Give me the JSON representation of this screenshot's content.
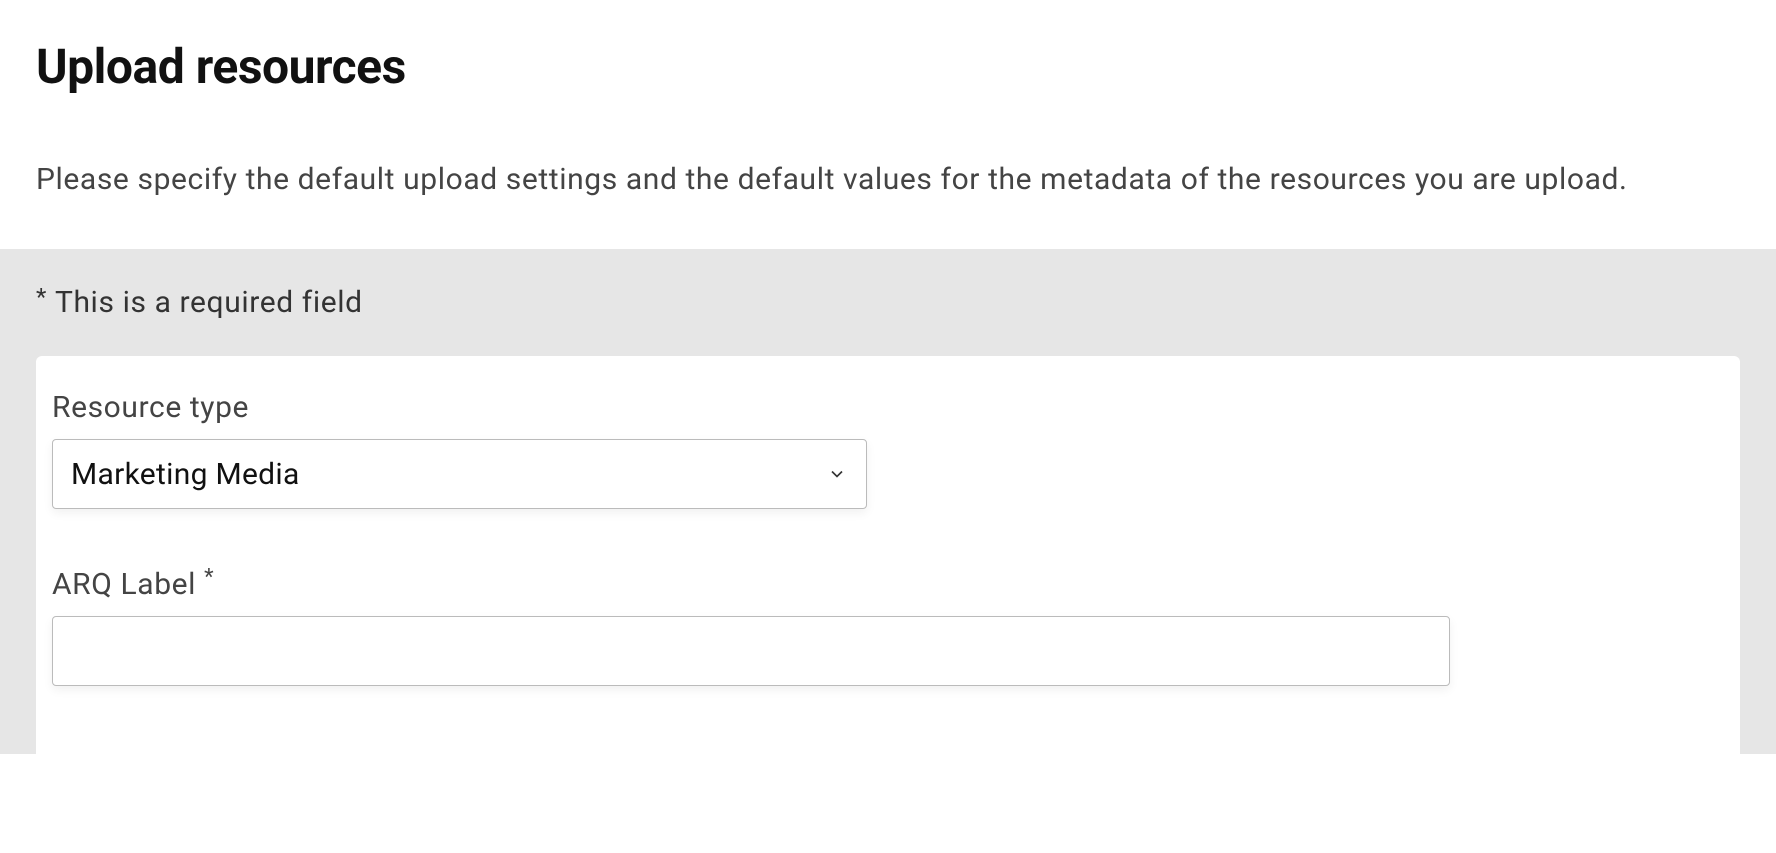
{
  "header": {
    "title": "Upload resources",
    "description": "Please specify the default upload settings and the default values for the metadata of the resources you are upload."
  },
  "form": {
    "required_note_asterisk": "*",
    "required_note_text": "This is a required field",
    "resource_type": {
      "label": "Resource type",
      "value": "Marketing Media"
    },
    "arq_label": {
      "label": "ARQ Label",
      "required_marker": "*",
      "value": ""
    }
  }
}
